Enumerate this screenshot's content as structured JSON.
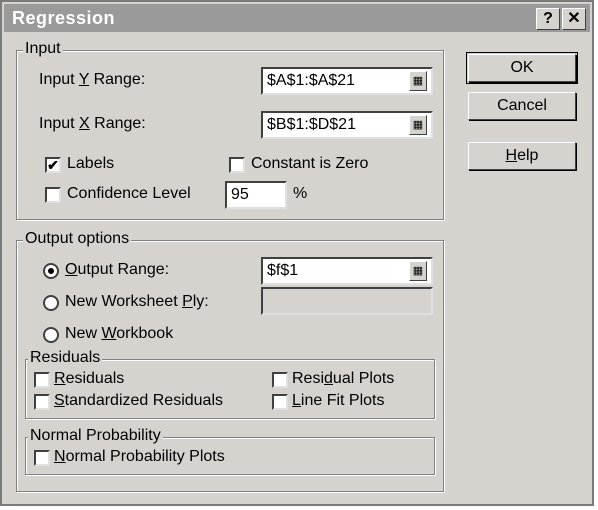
{
  "window": {
    "title": "Regression"
  },
  "titlebar": {
    "help_label": "?",
    "close_label": "✕"
  },
  "input": {
    "legend": "Input",
    "y_range_label": "Input Y Range:",
    "y_range_value": "$A$1:$A$21",
    "x_range_label": "Input X Range:",
    "x_range_value": "$B$1:$D$21",
    "labels_label": "Labels",
    "labels_checked": true,
    "constant_zero_label": "Constant is Zero",
    "confidence_label": "Confidence Level",
    "confidence_value": "95",
    "percent": "%"
  },
  "output": {
    "legend": "Output options",
    "output_range_label": "Output Range:",
    "output_range_value": "$f$1",
    "new_ply_label": "New Worksheet Ply:",
    "new_workbook_label": "New Workbook",
    "selected": "output_range"
  },
  "residuals": {
    "legend": "Residuals",
    "residuals_label": "Residuals",
    "standardized_label": "Standardized Residuals",
    "residual_plots_label": "Residual Plots",
    "line_fit_label": "Line Fit Plots"
  },
  "normal": {
    "legend": "Normal Probability",
    "plots_label": "Normal Probability Plots"
  },
  "buttons": {
    "ok": "OK",
    "cancel": "Cancel",
    "help": "Help"
  },
  "icons": {
    "range_picker": "range-picker-icon"
  }
}
